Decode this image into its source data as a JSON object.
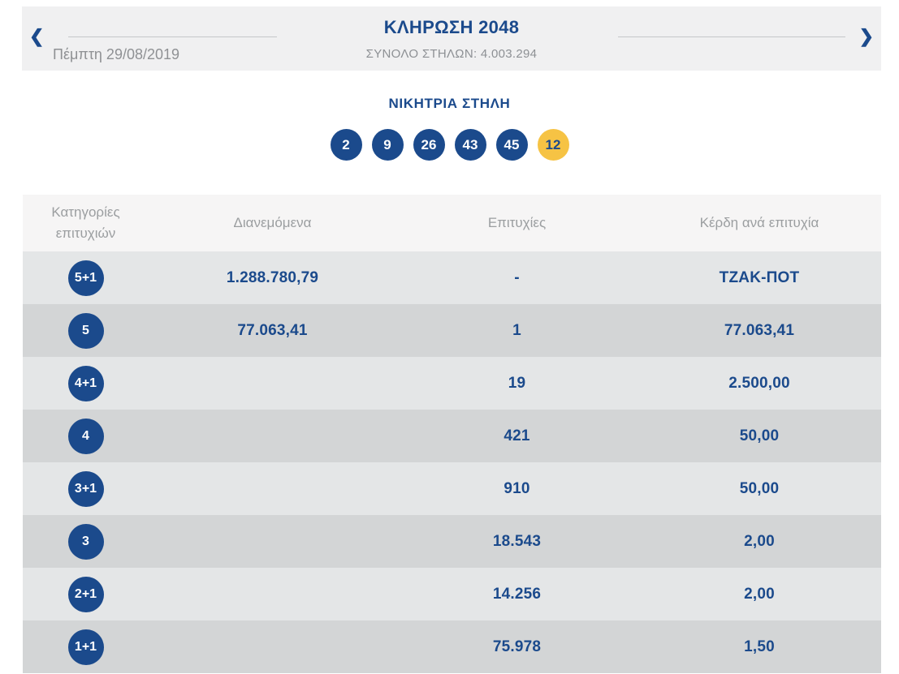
{
  "colors": {
    "navy": "#1b4a8c",
    "joker_yellow": "#f6c344",
    "band_bg": "#f0f0f1",
    "row_light": "#e4e6e7",
    "row_dark": "#d3d5d6",
    "muted_text": "#8f9194"
  },
  "nav": {
    "prev_icon": "❮",
    "next_icon": "❯",
    "title": "ΚΛΗΡΩΣΗ 2048",
    "subtitle": "ΣΥΝΟΛΟ ΣΤΗΛΩΝ: 4.003.294",
    "date": "Πέμπτη 29/08/2019"
  },
  "winning_column": {
    "label": "ΝΙΚΗΤΡΙΑ ΣΤΗΛΗ",
    "numbers": [
      {
        "value": "2",
        "type": "main"
      },
      {
        "value": "9",
        "type": "main"
      },
      {
        "value": "26",
        "type": "main"
      },
      {
        "value": "43",
        "type": "main"
      },
      {
        "value": "45",
        "type": "main"
      },
      {
        "value": "12",
        "type": "joker"
      }
    ]
  },
  "table": {
    "headers": {
      "category": "Κατηγορίες επιτυχιών",
      "distributed": "Διανεμόμενα",
      "winners": "Επιτυχίες",
      "prize": "Κέρδη ανά επιτυχία"
    },
    "rows": [
      {
        "category": "5+1",
        "distributed": "1.288.780,79",
        "winners": "-",
        "prize": "ΤΖΑΚ-ΠΟΤ"
      },
      {
        "category": "5",
        "distributed": "77.063,41",
        "winners": "1",
        "prize": "77.063,41"
      },
      {
        "category": "4+1",
        "distributed": "",
        "winners": "19",
        "prize": "2.500,00"
      },
      {
        "category": "4",
        "distributed": "",
        "winners": "421",
        "prize": "50,00"
      },
      {
        "category": "3+1",
        "distributed": "",
        "winners": "910",
        "prize": "50,00"
      },
      {
        "category": "3",
        "distributed": "",
        "winners": "18.543",
        "prize": "2,00"
      },
      {
        "category": "2+1",
        "distributed": "",
        "winners": "14.256",
        "prize": "2,00"
      },
      {
        "category": "1+1",
        "distributed": "",
        "winners": "75.978",
        "prize": "1,50"
      }
    ]
  }
}
